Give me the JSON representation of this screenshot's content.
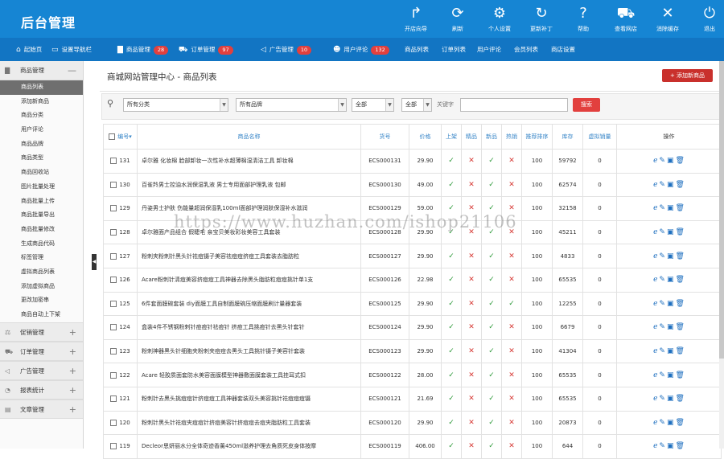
{
  "app": {
    "title": "后台管理"
  },
  "toolbar": [
    {
      "label": "开店向导",
      "icon": "share-icon",
      "glyph": "↱"
    },
    {
      "label": "刷新",
      "icon": "refresh-icon",
      "glyph": "⟳"
    },
    {
      "label": "个人设置",
      "icon": "gear-icon",
      "glyph": "⚙"
    },
    {
      "label": "更新补丁",
      "icon": "update-icon",
      "glyph": "↻"
    },
    {
      "label": "帮助",
      "icon": "help-icon",
      "glyph": "?"
    },
    {
      "label": "查看网店",
      "icon": "cart-icon",
      "glyph": "⛟"
    },
    {
      "label": "消除缓存",
      "icon": "close-circle-icon",
      "glyph": "✕"
    },
    {
      "label": "退出",
      "icon": "power-icon",
      "glyph": "⏻"
    }
  ],
  "nav": [
    {
      "label": "起始页",
      "icon": "home-icon",
      "glyph": "⌂",
      "badge": ""
    },
    {
      "label": "设置导航栏",
      "icon": "monitor-icon",
      "glyph": "▭",
      "badge": ""
    },
    {
      "label": "商品管理",
      "icon": "folder-icon",
      "glyph": "▇",
      "badge": "28"
    },
    {
      "label": "订单管理",
      "icon": "cart-icon",
      "glyph": "⛟",
      "badge": "97"
    },
    {
      "label": "广告管理",
      "icon": "megaphone-icon",
      "glyph": "◁",
      "badge": "10"
    },
    {
      "label": "用户评论",
      "icon": "users-icon",
      "glyph": "☻",
      "badge": "132"
    },
    {
      "label": "商品列表",
      "icon": "",
      "glyph": "",
      "badge": ""
    },
    {
      "label": "订单列表",
      "icon": "",
      "glyph": "",
      "badge": ""
    },
    {
      "label": "用户评论",
      "icon": "",
      "glyph": "",
      "badge": ""
    },
    {
      "label": "会员列表",
      "icon": "",
      "glyph": "",
      "badge": ""
    },
    {
      "label": "商店设置",
      "icon": "",
      "glyph": "",
      "badge": ""
    }
  ],
  "sidebar": {
    "top_section": {
      "label": "商品管理",
      "toggle": "—"
    },
    "items": [
      "商品列表",
      "添加新商品",
      "商品分类",
      "用户评论",
      "商品品牌",
      "商品类型",
      "商品回收站",
      "图片批量处理",
      "商品批量上传",
      "商品批量导出",
      "商品批量修改",
      "生成商品代码",
      "标签管理",
      "虚拟商品列表",
      "添加虚拟商品",
      "更改加密串",
      "商品自动上下架"
    ],
    "active_index": 0,
    "sections": [
      {
        "label": "促销管理",
        "icon": "gavel-icon",
        "glyph": "⚖",
        "toggle": "+"
      },
      {
        "label": "订单管理",
        "icon": "cart-icon",
        "glyph": "⛟",
        "toggle": "+"
      },
      {
        "label": "广告管理",
        "icon": "megaphone-icon",
        "glyph": "◁",
        "toggle": "+"
      },
      {
        "label": "报表统计",
        "icon": "pie-icon",
        "glyph": "◔",
        "toggle": "+"
      },
      {
        "label": "文章管理",
        "icon": "document-icon",
        "glyph": "▤",
        "toggle": "+"
      }
    ]
  },
  "page": {
    "title": "商城网站管理中心 - 商品列表",
    "add_button": "+ 添加新商品"
  },
  "filter": {
    "category": "所有分类",
    "brand": "所有品牌",
    "status1": "全部",
    "status2": "全部",
    "keyword_label": "关键字",
    "keyword_value": "",
    "search_button": "搜索"
  },
  "table": {
    "headers": [
      "编号",
      "商品名称",
      "货号",
      "价格",
      "上架",
      "精品",
      "新品",
      "热销",
      "推荐排序",
      "库存",
      "虚拟销量",
      "操作"
    ],
    "rows": [
      {
        "id": "131",
        "name": "卓尔雅 化妆棉 脸部卸妆一次性补水超薄棉湿清洁工具 卸妆棉",
        "sn": "ECS000131",
        "price": "29.90",
        "onsale": true,
        "best": false,
        "new": true,
        "hot": false,
        "sort": "100",
        "stock": "59792",
        "virtual": "0"
      },
      {
        "id": "130",
        "name": "百雀羚男士控油水润保湿乳液 男士专用面部护理乳液 包邮",
        "sn": "ECS000130",
        "price": "49.00",
        "onsale": true,
        "best": false,
        "new": true,
        "hot": false,
        "sort": "100",
        "stock": "62574",
        "virtual": "0"
      },
      {
        "id": "129",
        "name": "丹姿男士护肤 伤能量超润保湿乳100ml面部护理润肤保湿补水滋润",
        "sn": "ECS000129",
        "price": "59.00",
        "onsale": true,
        "best": false,
        "new": true,
        "hot": false,
        "sort": "100",
        "stock": "32158",
        "virtual": "0"
      },
      {
        "id": "128",
        "name": "卓尔雅面产品组合 假睫毛 亲宝贝美妆彩妆美容工具套装",
        "sn": "ECS000128",
        "price": "29.90",
        "onsale": true,
        "best": false,
        "new": true,
        "hot": false,
        "sort": "100",
        "stock": "45211",
        "virtual": "0"
      },
      {
        "id": "127",
        "name": "粉刺夹粉刺针黑头针祛痘镊子美容祛痘痘挤痘工具套装去脂肪粒",
        "sn": "ECS000127",
        "price": "29.90",
        "onsale": true,
        "best": false,
        "new": true,
        "hot": false,
        "sort": "100",
        "stock": "4833",
        "virtual": "0"
      },
      {
        "id": "126",
        "name": "Acare粉刺针清痘美容挤痘痘工具神器去除黑头脂肪粒痘痘挑针单1支",
        "sn": "ECS000126",
        "price": "22.98",
        "onsale": true,
        "best": false,
        "new": true,
        "hot": false,
        "sort": "100",
        "stock": "65535",
        "virtual": "0"
      },
      {
        "id": "125",
        "name": "6件套面膜碗套装 diy面膜工具自制面膜碗压缩面膜刷计量器套装",
        "sn": "ECS000125",
        "price": "29.90",
        "onsale": true,
        "best": false,
        "new": true,
        "hot": true,
        "sort": "100",
        "stock": "12255",
        "virtual": "0"
      },
      {
        "id": "124",
        "name": "盒装4件不锈钢粉刺针痘痘针祛痘针 挤痘工具挑痘针去黑头针套针",
        "sn": "ECS000124",
        "price": "29.90",
        "onsale": true,
        "best": false,
        "new": true,
        "hot": false,
        "sort": "100",
        "stock": "6679",
        "virtual": "0"
      },
      {
        "id": "123",
        "name": "粉刺神器黑头针细胞夹粉刺夹痘痘去黑头工具挑针镊子美容针套装",
        "sn": "ECS000123",
        "price": "29.90",
        "onsale": true,
        "best": false,
        "new": true,
        "hot": false,
        "sort": "100",
        "stock": "41304",
        "virtual": "0"
      },
      {
        "id": "122",
        "name": "Acare 轻胶质面套防水美容面膜模型神器敷面膜套装工具挂耳式扣",
        "sn": "ECS000122",
        "price": "28.00",
        "onsale": true,
        "best": false,
        "new": true,
        "hot": false,
        "sort": "100",
        "stock": "65535",
        "virtual": "0"
      },
      {
        "id": "121",
        "name": "粉刺针去黑头挑痘痘针挤痘痘工具神器套装双头美容挑针祛痘痘痘镊",
        "sn": "ECS000121",
        "price": "21.69",
        "onsale": true,
        "best": false,
        "new": true,
        "hot": false,
        "sort": "100",
        "stock": "65535",
        "virtual": "0"
      },
      {
        "id": "120",
        "name": "粉刺针黑头针祛痘夹痘痘针挤痘美容针挤痘痘去痘夹脂肪粒工具套装",
        "sn": "ECS000120",
        "price": "29.90",
        "onsale": true,
        "best": false,
        "new": true,
        "hot": false,
        "sort": "100",
        "stock": "20873",
        "virtual": "0"
      },
      {
        "id": "119",
        "name": "Decleor思妍丽水分全体奇迹香薰450ml滋养护理去角质死皮身体按摩",
        "sn": "ECS000119",
        "price": "406.00",
        "onsale": true,
        "best": false,
        "new": true,
        "hot": false,
        "sort": "100",
        "stock": "644",
        "virtual": "0"
      }
    ],
    "action_icons": [
      "browser-icon",
      "edit-icon",
      "copy-icon",
      "trash-icon"
    ]
  },
  "watermark": "https://www.huzhan.com/ishop21106",
  "colors": {
    "topbar": "#1685d3",
    "navbar": "#1275c3",
    "badge": "#e2403e",
    "check": "#2f9a3b",
    "cross": "#d73a35",
    "link": "#3a87c8"
  }
}
